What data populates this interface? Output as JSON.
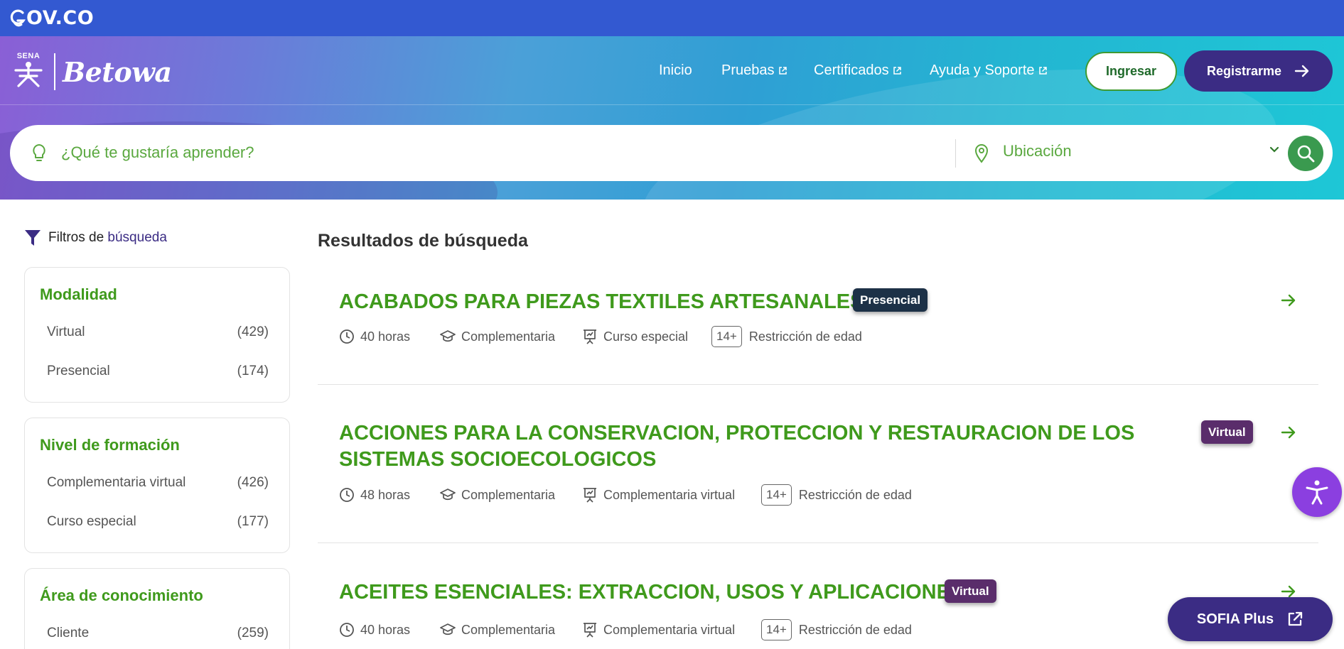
{
  "gov": {
    "logo": "OV.CO"
  },
  "header": {
    "brand": "Betowa",
    "sena_text": "SENA",
    "nav": [
      {
        "label": "Inicio",
        "external": false
      },
      {
        "label": "Pruebas",
        "external": true
      },
      {
        "label": "Certificados",
        "external": true
      },
      {
        "label": "Ayuda y Soporte",
        "external": true
      }
    ],
    "login_label": "Ingresar",
    "register_label": "Registrarme"
  },
  "search": {
    "placeholder": "¿Qué te gustaría aprender?",
    "location_label": "Ubicación"
  },
  "sidebar": {
    "filters_label_1": "Filtros de",
    "filters_label_2": "búsqueda",
    "groups": [
      {
        "title": "Modalidad",
        "items": [
          {
            "label": "Virtual",
            "count": "(429)"
          },
          {
            "label": "Presencial",
            "count": "(174)"
          }
        ]
      },
      {
        "title": "Nivel de formación",
        "items": [
          {
            "label": "Complementaria virtual",
            "count": "(426)"
          },
          {
            "label": "Curso especial",
            "count": "(177)"
          }
        ]
      },
      {
        "title": "Área de conocimiento",
        "items": [
          {
            "label": "Cliente",
            "count": "(259)"
          }
        ]
      }
    ]
  },
  "results": {
    "title": "Resultados de búsqueda",
    "items": [
      {
        "title": "ACABADOS PARA PIEZAS TEXTILES ARTESANALES",
        "badge": "Presencial",
        "hours": "40 horas",
        "type": "Complementaria",
        "level": "Curso especial",
        "age": "14+",
        "age_label": "Restricción de edad"
      },
      {
        "title_line1": "ACCIONES PARA LA CONSERVACION, PROTECCION Y RESTAURACION DE LOS",
        "title_line2": "SISTEMAS SOCIOECOLOGICOS",
        "badge": "Virtual",
        "hours": "48 horas",
        "type": "Complementaria",
        "level": "Complementaria virtual",
        "age": "14+",
        "age_label": "Restricción de edad"
      },
      {
        "title": "ACEITES ESENCIALES: EXTRACCION, USOS Y APLICACIONES",
        "badge": "Virtual",
        "hours": "40 horas",
        "type": "Complementaria",
        "level": "Complementaria virtual",
        "age": "14+",
        "age_label": "Restricción de edad"
      }
    ]
  },
  "floating": {
    "sofia_label": "SOFIA Plus"
  },
  "colors": {
    "gov_blue": "#3359d1",
    "brand_purple": "#3b2c84",
    "accent_green": "#3f9a1c",
    "badge_presencial": "#1d3147",
    "badge_virtual": "#5a2d6b",
    "access_purple": "#8b3fe0"
  }
}
